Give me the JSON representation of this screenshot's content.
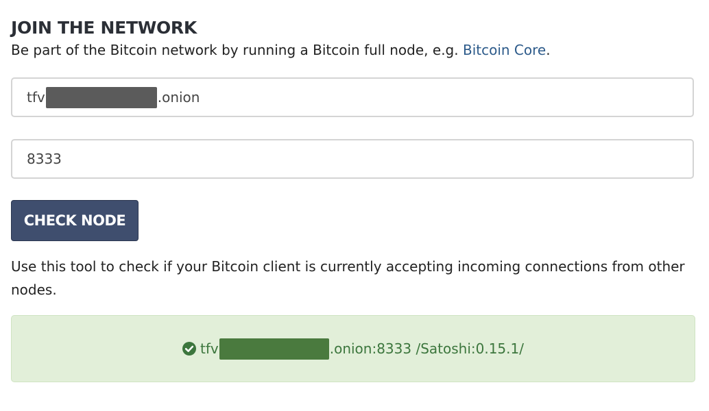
{
  "header": {
    "title": "JOIN THE NETWORK",
    "intro_prefix": "Be part of the Bitcoin network by running a Bitcoin full node, e.g. ",
    "intro_link": "Bitcoin Core",
    "intro_suffix": "."
  },
  "form": {
    "host_prefix": "tfv",
    "host_suffix": ".onion",
    "port_value": "8333",
    "check_button_label": "CHECK NODE"
  },
  "help_text": "Use this tool to check if your Bitcoin client is currently accepting incoming connections from other nodes.",
  "result": {
    "icon": "check-circle-icon",
    "prefix": "tfv",
    "suffix": ".onion:8333 /Satoshi:0.15.1/"
  },
  "colors": {
    "button_bg": "#3f4e6e",
    "link": "#2c5a8a",
    "success_bg": "#e2efd9",
    "success_text": "#3c763d"
  }
}
